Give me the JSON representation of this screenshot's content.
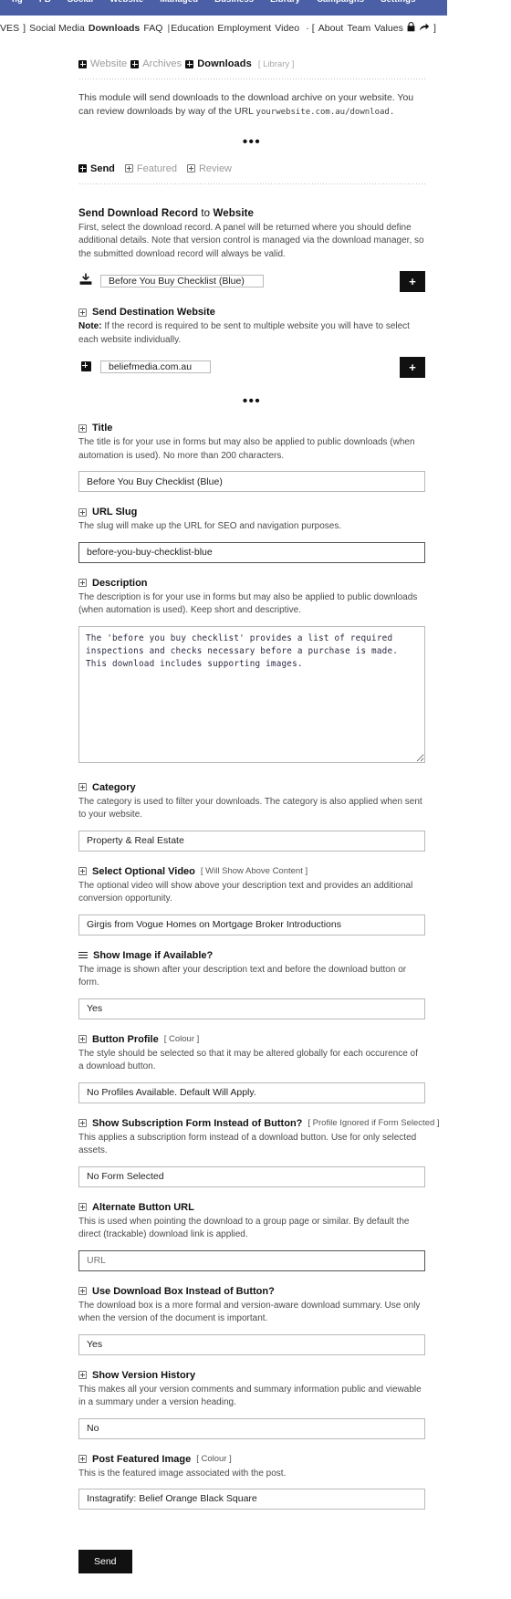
{
  "topnav": {
    "items": [
      "ng",
      "FB",
      "Social",
      "Website",
      "Managed",
      "Business",
      "Library",
      "Campaigns",
      "Settings"
    ],
    "bg_color": "#4a5fa5"
  },
  "subnav": {
    "prefix": "VES",
    "close_bracket": "]",
    "items": [
      "Social Media",
      "Downloads",
      "FAQ",
      "Education",
      "Employment",
      "Video"
    ],
    "active": "Downloads",
    "pipe": "|",
    "dot": "·",
    "open_bracket": "[",
    "items2": [
      "About",
      "Team",
      "Values"
    ],
    "end_bracket": "]",
    "lock_icon": "lock-icon",
    "share_icon": "share-icon"
  },
  "breadcrumb": {
    "items": [
      {
        "label": "Website",
        "active": false
      },
      {
        "label": "Archives",
        "active": false
      },
      {
        "label": "Downloads",
        "active": true
      }
    ],
    "suffix": "[ Library ]"
  },
  "intro": {
    "text": "This module will send downloads to the download archive on your website. You can review downloads by way of the URL ",
    "url": "yourwebsite.com.au/download."
  },
  "ellipsis": "•••",
  "tabs": [
    {
      "label": "Send",
      "active": true,
      "icon": "plus-solid-icon"
    },
    {
      "label": "Featured",
      "active": false,
      "icon": "plus-outline-icon"
    },
    {
      "label": "Review",
      "active": false,
      "icon": "plus-outline-icon"
    }
  ],
  "section": {
    "title_a": "Send Download Record",
    "title_b": "to",
    "title_c": "Website",
    "hint": "First, select the download record. A panel will be returned where you should define additional details. Note that version control is managed via the download manager, so the submitted download record will always be valid."
  },
  "download_record": {
    "icon": "download-tray-icon",
    "value": "Before You Buy Checklist (Blue)",
    "add_button": "+"
  },
  "destination": {
    "icon": "plus-outline-icon",
    "label": "Send Destination Website",
    "note_label": "Note:",
    "note_text": " If the record is required to be sent to multiple website you will have to select each website individually.",
    "row_icon": "plus-solid-icon",
    "value": "beliefmedia.com.au",
    "add_button": "+"
  },
  "fields": {
    "title": {
      "icon": "plus-outline-icon",
      "label": "Title",
      "hint": "The title is for your use in forms but may also be applied to public downloads (when automation is used). No more than 200 characters.",
      "value": "Before You Buy Checklist (Blue)"
    },
    "slug": {
      "icon": "plus-outline-icon",
      "label": "URL Slug",
      "hint": "The slug will make up the URL for SEO and navigation purposes.",
      "value": "before-you-buy-checklist-blue"
    },
    "description": {
      "icon": "plus-outline-icon",
      "label": "Description",
      "hint": "The description is for your use in forms but may also be applied to public downloads (when automation is used). Keep short and descriptive.",
      "value": "The 'before you buy checklist' provides a list of required inspections and checks necessary before a purchase is made. This download includes supporting images."
    },
    "category": {
      "icon": "plus-outline-icon",
      "label": "Category",
      "hint": "The category is used to filter your downloads. The category is also applied when sent to your website.",
      "value": "Property & Real Estate"
    },
    "video": {
      "icon": "plus-outline-icon",
      "label": "Select Optional Video",
      "suffix": "[ Will Show Above Content ]",
      "hint": "The optional video will show above your description text and provides an additional conversion opportunity.",
      "value": "Girgis from Vogue Homes on Mortgage Broker Introductions"
    },
    "show_image": {
      "icon": "hamburger-icon",
      "label": "Show Image if Available?",
      "hint": "The image is shown after your description text and before the download button or form.",
      "value": "Yes"
    },
    "button_profile": {
      "icon": "plus-outline-icon",
      "label": "Button Profile",
      "suffix": "[ Colour ]",
      "hint": "The style should be selected so that it may be altered globally for each occurence of a download button.",
      "value": "No Profiles Available. Default Will Apply."
    },
    "subscription_form": {
      "icon": "plus-outline-icon",
      "label": "Show Subscription Form Instead of Button?",
      "suffix": "[ Profile Ignored if Form Selected ]",
      "hint": "This applies a subscription form instead of a download button. Use for only selected assets.",
      "value": "No Form Selected"
    },
    "alternate_url": {
      "icon": "plus-outline-icon",
      "label": "Alternate Button URL",
      "hint": "This is used when pointing the download to a group page or similar. By default the direct (trackable) download link is applied.",
      "placeholder": "URL",
      "value": ""
    },
    "download_box": {
      "icon": "plus-outline-icon",
      "label": "Use Download Box Instead of Button?",
      "hint": "The download box is a more formal and version-aware download summary. Use only when the version of the document is important.",
      "value": "Yes"
    },
    "version_history": {
      "icon": "plus-outline-icon",
      "label": "Show Version History",
      "hint": "This makes all your version comments and summary information public and viewable in a summary under a version heading.",
      "value": "No"
    },
    "featured_image": {
      "icon": "plus-outline-icon",
      "label": "Post Featured Image",
      "suffix": "[ Colour ]",
      "hint": "This is the featured image associated with the post.",
      "value": "Instagratify: Belief Orange Black Square"
    }
  },
  "submit": {
    "label": "Send"
  }
}
